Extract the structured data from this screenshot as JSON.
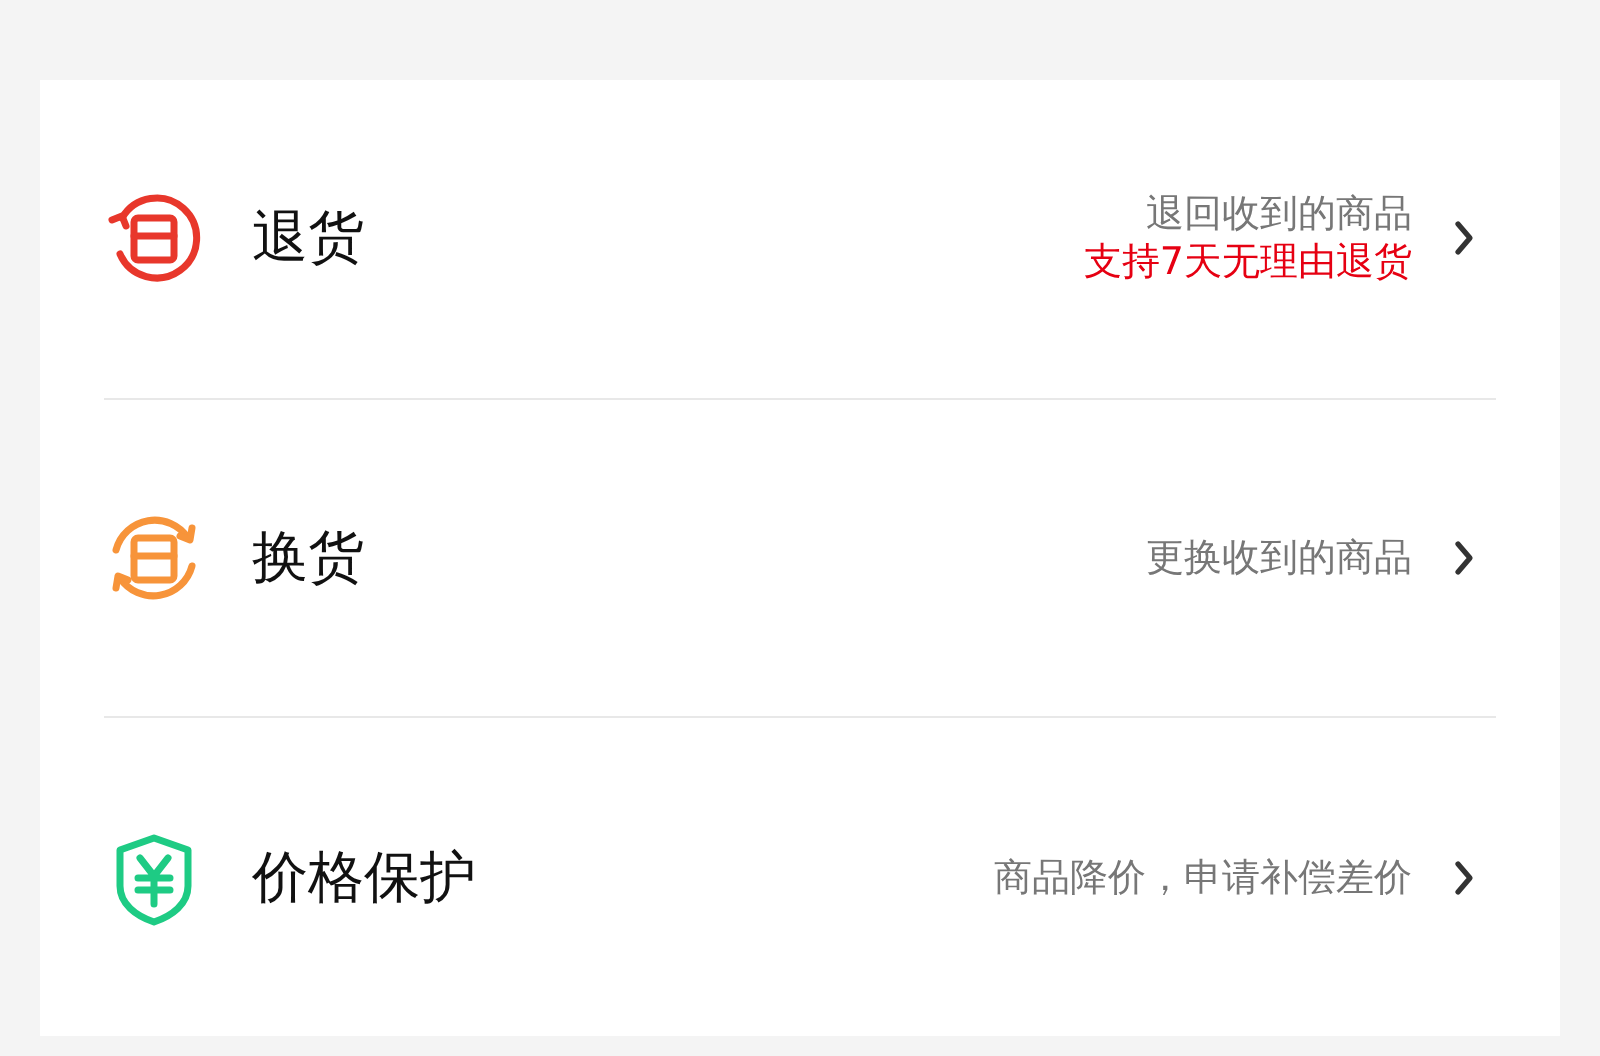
{
  "options": [
    {
      "kind": "return",
      "title": "退货",
      "description": "退回收到的商品",
      "note": "支持7天无理由退货"
    },
    {
      "kind": "exchange",
      "title": "换货",
      "description": "更换收到的商品"
    },
    {
      "kind": "price",
      "title": "价格保护",
      "description": "商品降价，申请补偿差价"
    }
  ]
}
